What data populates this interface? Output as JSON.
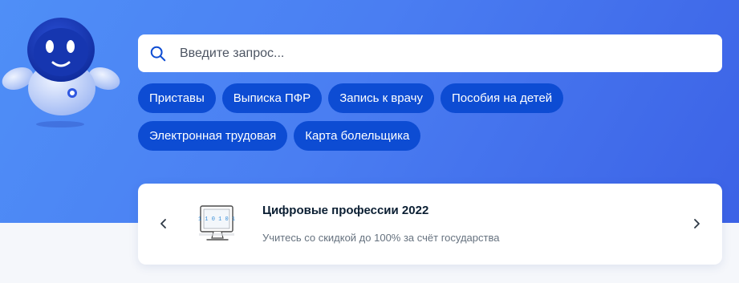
{
  "search": {
    "placeholder": "Введите запрос..."
  },
  "quick_links": [
    [
      "Приставы",
      "Выписка ПФР",
      "Запись к врачу",
      "Пособия на детей"
    ],
    [
      "Электронная трудовая",
      "Карта болельщика"
    ]
  ],
  "promo": {
    "title": "Цифровые профессии 2022",
    "subtitle": "Учитесь со скидкой до 100% за счёт государства",
    "illustration_text": "1 1 0 1 0 1"
  },
  "icons": {
    "search": "search-icon",
    "prev": "chevron-left-icon",
    "next": "chevron-right-icon",
    "mascot": "robot-mascot",
    "illustration": "monitor-icon"
  },
  "colors": {
    "hero_gradient_start": "#4f8ff7",
    "hero_gradient_end": "#3c62e6",
    "chip_background": "#0d4cd3",
    "chip_text": "#ffffff",
    "search_icon": "#0d4cd3",
    "page_background": "#f5f7fb"
  }
}
